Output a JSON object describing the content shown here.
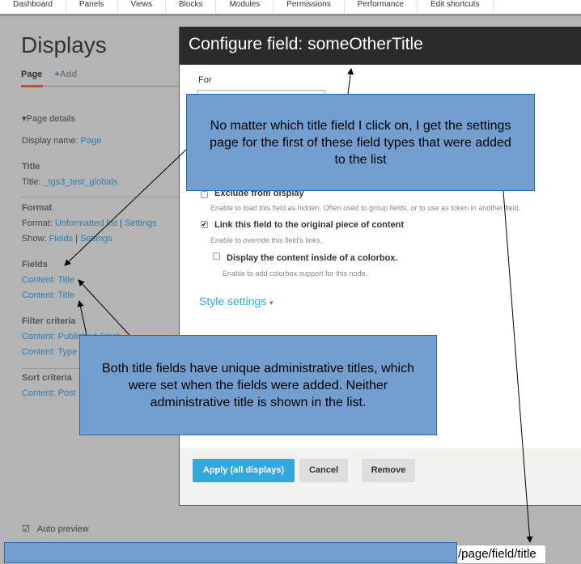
{
  "topnav": [
    "Dashboard",
    "Panels",
    "Views",
    "Blocks",
    "Modules",
    "Permissions",
    "Performance",
    "Edit shortcuts"
  ],
  "page": {
    "title": "Displays",
    "tab_page": "Page",
    "tab_add": "Add"
  },
  "sidebar": {
    "page_details": "Page details",
    "display_name_label": "Display name:",
    "display_name_value": "Page",
    "title_heading": "Title",
    "title_label": "Title:",
    "title_value": "_tgs3_test_globals",
    "format_heading": "Format",
    "format_label": "Format:",
    "format_value": "Unformatted list",
    "format_settings": "Settings",
    "show_label": "Show:",
    "show_value": "Fields",
    "show_settings": "Settings",
    "fields_heading": "Fields",
    "fields": [
      "Content: Title",
      "Content: Title"
    ],
    "filter_heading": "Filter criteria",
    "filters": [
      "Content: Published (Yes)",
      "Content: Type"
    ],
    "sort_heading": "Sort criteria",
    "sorts": [
      "Content: Post"
    ],
    "auto_preview": "Auto preview"
  },
  "modal": {
    "title": "Configure field: someOtherTitle",
    "for_label": "For",
    "exclude_label": "Exclude from display",
    "exclude_desc": "Enable to load this field as hidden. Often used to group fields, or to use as token in another field.",
    "link_label": "Link this field to the original piece of content",
    "link_desc": "Enable to override this field's links.",
    "colorbox_label": "Display the content inside of a colorbox.",
    "colorbox_desc": "Enable to add colorbox support for this node.",
    "style_settings": "Style settings",
    "apply": "Apply (all displays)",
    "cancel": "Cancel",
    "remove": "Remove"
  },
  "annotations": {
    "callout_top": "No matter which title field I click on, I get the settings page for the first of these field types that were added to the list",
    "callout_bottom": "Both title fields have unique administrative titles, which were set when the fields were added. Neither administrative title is shown in the list.",
    "url_tail": "/page/field/title"
  },
  "colors": {
    "accent": "#2fa9e0",
    "callout": "#729fcf",
    "header": "#2b2b2b"
  }
}
